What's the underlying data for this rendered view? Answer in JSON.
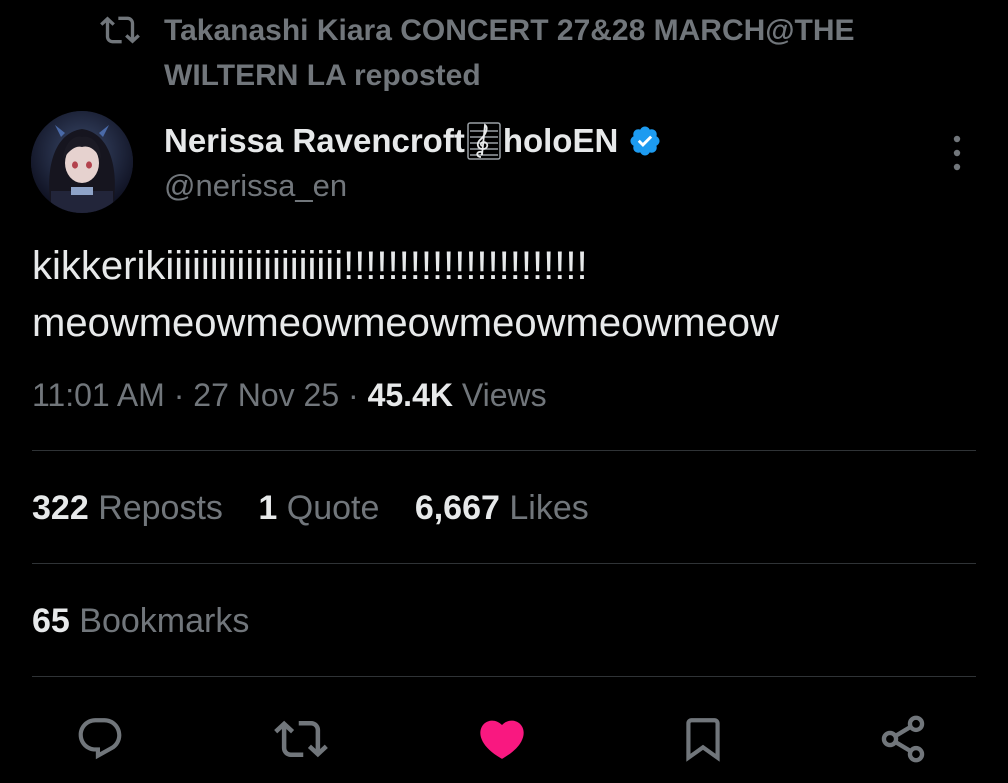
{
  "repost_banner": {
    "text": "Takanashi Kiara CONCERT 27&28 MARCH@THE WILTERN LA reposted"
  },
  "author": {
    "display_name": "Nerissa Ravencroft",
    "display_name_suffix": "holoEN",
    "handle": "@nerissa_en",
    "verified": true,
    "avatar_icon": "avatar-image"
  },
  "tweet": {
    "line1": "kikkerikiiiiiiiiiiiiiiiiiiii!!!!!!!!!!!!!!!!!!!!!!",
    "line2": "meowmeowmeowmeowmeowmeowmeow"
  },
  "meta": {
    "time": "11:01 AM",
    "date": "27 Nov 25",
    "separator": "·",
    "views_count": "45.4K",
    "views_label": "Views"
  },
  "stats": {
    "reposts_count": "322",
    "reposts_label": "Reposts",
    "quotes_count": "1",
    "quotes_label": "Quote",
    "likes_count": "6,667",
    "likes_label": "Likes",
    "bookmarks_count": "65",
    "bookmarks_label": "Bookmarks"
  },
  "actions": [
    {
      "icon": "reply-icon"
    },
    {
      "icon": "repost-icon"
    },
    {
      "icon": "like-icon",
      "active": true
    },
    {
      "icon": "bookmark-icon"
    },
    {
      "icon": "share-icon"
    }
  ],
  "colors": {
    "background": "#000000",
    "text_primary": "#e7e9ea",
    "text_secondary": "#71767b",
    "divider": "#2f3336",
    "verified": "#1d9bf0",
    "like_active": "#f91880"
  }
}
